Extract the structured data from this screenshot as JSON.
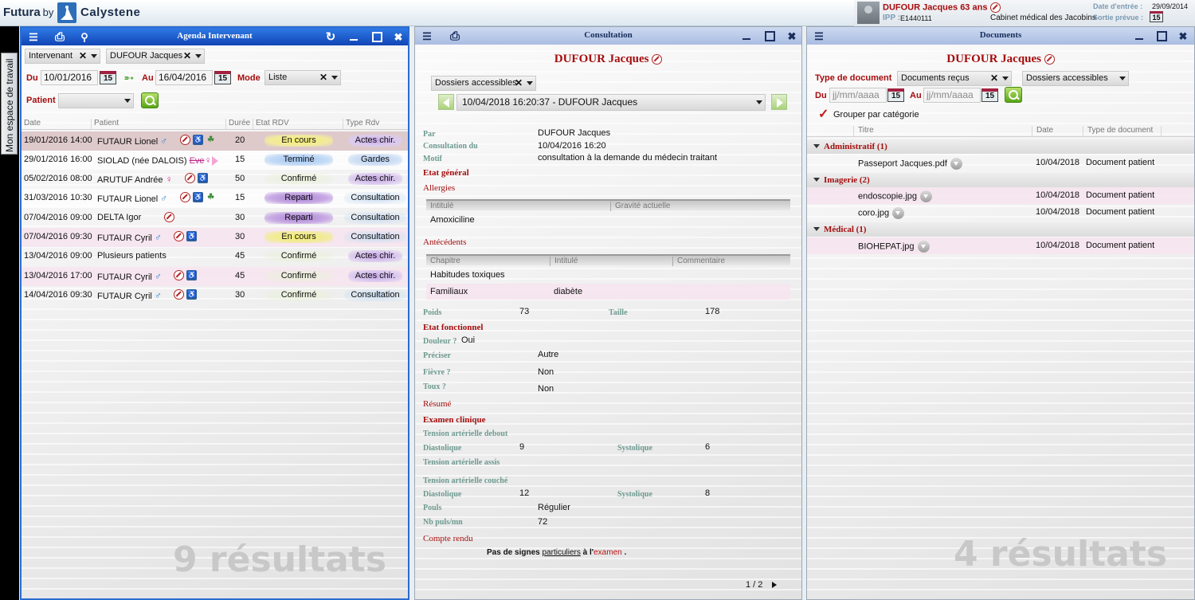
{
  "app": {
    "brand_futura": "Futura",
    "brand_by": "by",
    "brand_calystene": "Calystene",
    "sidetab_label": "Mon espace de travail"
  },
  "patient_header": {
    "name": "DUFOUR Jacques 63 ans",
    "ipp_label": "IPP :",
    "ipp": "E1440111",
    "cabinet": "Cabinet médical des Jacobins",
    "entry_label": "Date d'entrée :",
    "entry_date": "29/09/2014",
    "exit_label": "Sortie prévue :",
    "cal_day": "15"
  },
  "agenda": {
    "title": "Agenda Intervenant",
    "filter_intervenant": "Intervenant",
    "filter_person": "DUFOUR Jacques",
    "du_label": "Du",
    "du_value": "10/01/2016",
    "au_label": "Au",
    "au_value": "16/04/2016",
    "cal_day": "15",
    "mode_label": "Mode",
    "mode_value": "Liste",
    "patient_label": "Patient",
    "columns": [
      "Date",
      "Patient",
      "Durée",
      "Etat RDV",
      "Type Rdv"
    ],
    "rows": [
      {
        "date": "19/01/2016 14:00",
        "patient": "FUTAUR Lionel",
        "duree": "20",
        "etat": "En cours",
        "type": "Actes chir."
      },
      {
        "date": "29/01/2016 16:00",
        "patient": "SIOLAD (née DALOIS)",
        "extra": "Eve",
        "duree": "15",
        "etat": "Terminé",
        "type": "Gardes"
      },
      {
        "date": "05/02/2016 08:00",
        "patient": "ARUTUF Andrée",
        "duree": "50",
        "etat": "Confirmé",
        "type": "Actes chir."
      },
      {
        "date": "31/03/2016 10:30",
        "patient": "FUTAUR Lionel",
        "duree": "15",
        "etat": "Reparti",
        "type": "Consultation"
      },
      {
        "date": "07/04/2016 09:00",
        "patient": "DELTA Igor",
        "duree": "30",
        "etat": "Reparti",
        "type": "Consultation"
      },
      {
        "date": "07/04/2016 09:30",
        "patient": "FUTAUR Cyril",
        "duree": "30",
        "etat": "En cours",
        "type": "Consultation"
      },
      {
        "date": "13/04/2016 09:00",
        "patient": "Plusieurs patients",
        "duree": "45",
        "etat": "Confirmé",
        "type": "Actes chir."
      },
      {
        "date": "13/04/2016 17:00",
        "patient": "FUTAUR Cyril",
        "duree": "45",
        "etat": "Confirmé",
        "type": "Actes chir."
      },
      {
        "date": "14/04/2016 09:30",
        "patient": "FUTAUR Cyril",
        "duree": "30",
        "etat": "Confirmé",
        "type": "Consultation"
      }
    ],
    "result_count": "9 résultats"
  },
  "consultation": {
    "title": "Consultation",
    "patient_name": "DUFOUR Jacques",
    "dossiers": "Dossiers accessibles",
    "selected": "10/04/2018 16:20:37 - DUFOUR Jacques",
    "par_label": "Par",
    "par_value": "DUFOUR Jacques",
    "consult_du_label": "Consultation du",
    "consult_du_value": "10/04/2016 16:20",
    "motif_label": "Motif",
    "motif_value": "consultation à la demande du médecin traitant",
    "etat_general": "Etat général",
    "allergies": "Allergies",
    "allergies_cols": [
      "Intitulé",
      "Gravité actuelle"
    ],
    "allergies_rows": [
      {
        "intitule": "Amoxiciline",
        "gravite": ""
      }
    ],
    "antecedents": "Antécédents",
    "antecedents_cols": [
      "Chapitre",
      "Intitulé",
      "Commentaire"
    ],
    "antecedents_rows": [
      {
        "chapitre": "Habitudes toxiques",
        "intitule": "",
        "commentaire": ""
      },
      {
        "chapitre": "Familiaux",
        "intitule": "diabète",
        "commentaire": ""
      }
    ],
    "poids_label": "Poids",
    "poids_value": "73",
    "taille_label": "Taille",
    "taille_value": "178",
    "etat_fonctionnel": "Etat fonctionnel",
    "douleur_label": "Douleur ?",
    "douleur_value": "Oui",
    "preciser_label": "Préciser",
    "preciser_value": "Autre",
    "fievre_label": "Fièvre ?",
    "fievre_value": "Non",
    "toux_label": "Toux ?",
    "toux_value": "Non",
    "resume": "Résumé",
    "examen_clinique": "Examen clinique",
    "ta_debout": "Tension artérielle debout",
    "diastolique_label": "Diastolique",
    "systolique_label": "Systolique",
    "ta_debout_dia": "9",
    "ta_debout_sys": "6",
    "ta_assis": "Tension artérielle assis",
    "ta_couche": "Tension artérielle couché",
    "ta_couche_dia": "12",
    "ta_couche_sys": "8",
    "pouls_label": "Pouls",
    "pouls_value": "Régulier",
    "nb_puls_label": "Nb puls/mn",
    "nb_puls_value": "72",
    "compte_rendu": "Compte rendu",
    "cr_text_1": "Pas de signes",
    "cr_text_2": "particuliers",
    "cr_text_3": "à l'",
    "cr_text_4": "examen",
    "cr_text_5": ".",
    "pager": "1 / 2"
  },
  "documents": {
    "title": "Documents",
    "patient_name": "DUFOUR Jacques",
    "type_label": "Type de document",
    "type_value": "Documents reçus",
    "dossiers": "Dossiers accessibles",
    "du_label": "Du",
    "au_label": "Au",
    "date_placeholder": "jj/mm/aaaa",
    "cal_day": "15",
    "group_by": "Grouper par catégorie",
    "columns": [
      "Titre",
      "Date",
      "Type de document"
    ],
    "groups": [
      {
        "name": "Administratif (1)",
        "items": [
          {
            "titre": "Passeport Jacques.pdf",
            "date": "10/04/2018",
            "type": "Document patient"
          }
        ]
      },
      {
        "name": "Imagerie (2)",
        "items": [
          {
            "titre": "endoscopie.jpg",
            "date": "10/04/2018",
            "type": "Document patient"
          },
          {
            "titre": "coro.jpg",
            "date": "10/04/2018",
            "type": "Document patient"
          }
        ]
      },
      {
        "name": "Médical (1)",
        "items": [
          {
            "titre": "BIOHEPAT.jpg",
            "date": "10/04/2018",
            "type": "Document patient"
          }
        ]
      }
    ],
    "result_count": "4 résultats"
  }
}
